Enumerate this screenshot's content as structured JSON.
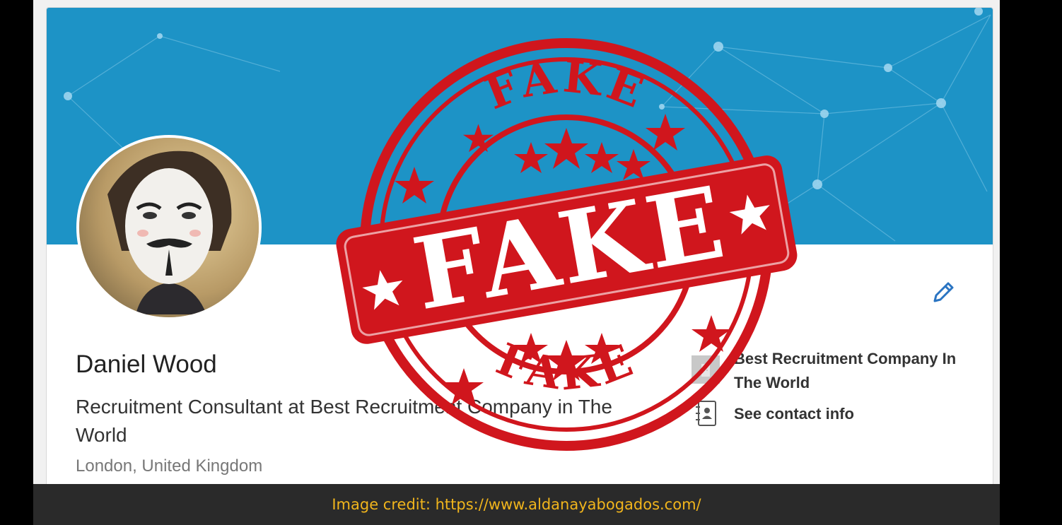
{
  "profile": {
    "name": "Daniel Wood",
    "headline": "Recruitment Consultant at Best Recruitment Company in The World",
    "location": "London, United Kingdom"
  },
  "sidebar": {
    "company": "Best Recruitment Company In The World",
    "contact_label": "See contact info"
  },
  "stamp": {
    "main_word": "FAKE",
    "top_word": "FAKE",
    "bottom_word": "FAKE",
    "color": "#d0161d"
  },
  "caption": "Image credit: https://www.aldanayabogados.com/",
  "colors": {
    "banner": "#1d93c6",
    "caption_text": "#f1b51c",
    "edit_icon": "#2a74c2"
  },
  "icons": [
    "edit-pencil-icon",
    "company-logo-icon",
    "contact-card-icon",
    "expand-icon"
  ]
}
